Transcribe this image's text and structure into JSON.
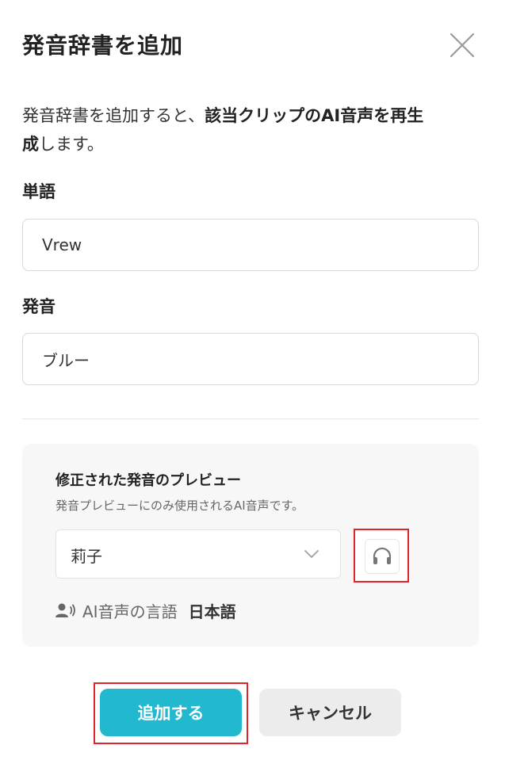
{
  "dialog": {
    "title": "発音辞書を追加",
    "description": {
      "prefix": "発音辞書を追加すると、",
      "bold1": "該当クリップのAI音声を再生",
      "bold2": "成",
      "suffix": "します。"
    }
  },
  "form": {
    "word_label": "単語",
    "word_value": "Vrew",
    "pronunciation_label": "発音",
    "pronunciation_value": "ブルー"
  },
  "preview": {
    "title": "修正された発音のプレビュー",
    "subtitle": "発音プレビューにのみ使用されるAI音声です。",
    "voice_selected": "莉子",
    "language_label": "AI音声の言語",
    "language_value": "日本語"
  },
  "buttons": {
    "add": "追加する",
    "cancel": "キャンセル"
  },
  "icons": {
    "close": "close-icon",
    "dropdown": "chevron-down-icon",
    "listen": "headphones-icon",
    "voice": "person-voice-icon"
  },
  "colors": {
    "accent": "#22b8cf",
    "highlight": "#e0242a",
    "panel_bg": "#f7f7f7",
    "cancel_bg": "#ececec"
  }
}
